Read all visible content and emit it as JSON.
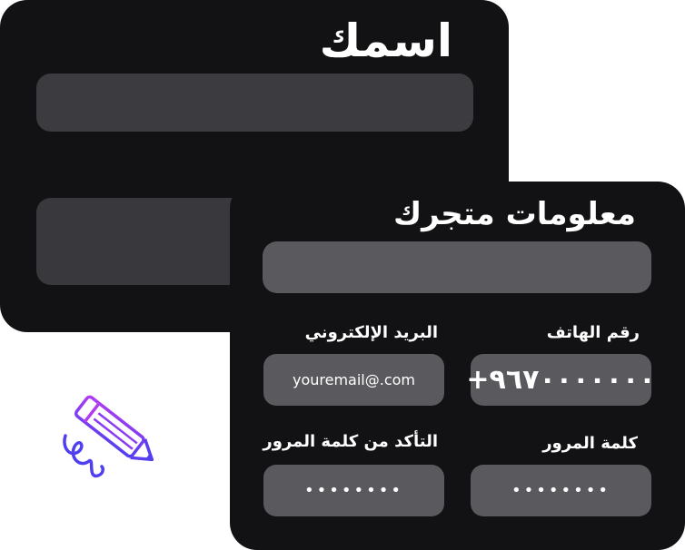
{
  "back_card": {
    "title": "اسمك"
  },
  "front_card": {
    "title": "معلومات متجرك",
    "phone": {
      "label": "رقم الهاتف",
      "value": "+٩٦٧٠٠٠٠٠٠٠"
    },
    "email": {
      "label": "البريد الإلكتروني",
      "value": "youremail@.com"
    },
    "password": {
      "label": "كلمة المرور",
      "value": "••••••••"
    },
    "confirm_password": {
      "label": "التأكد من كلمة المرور",
      "value": "••••••••"
    }
  },
  "colors": {
    "card_bg": "#121214",
    "field_bg": "#5a5a5e",
    "pencil_purple": "#a33bf2",
    "pencil_blue": "#4f3ff0"
  },
  "icons": {
    "pencil": "pencil-icon"
  }
}
